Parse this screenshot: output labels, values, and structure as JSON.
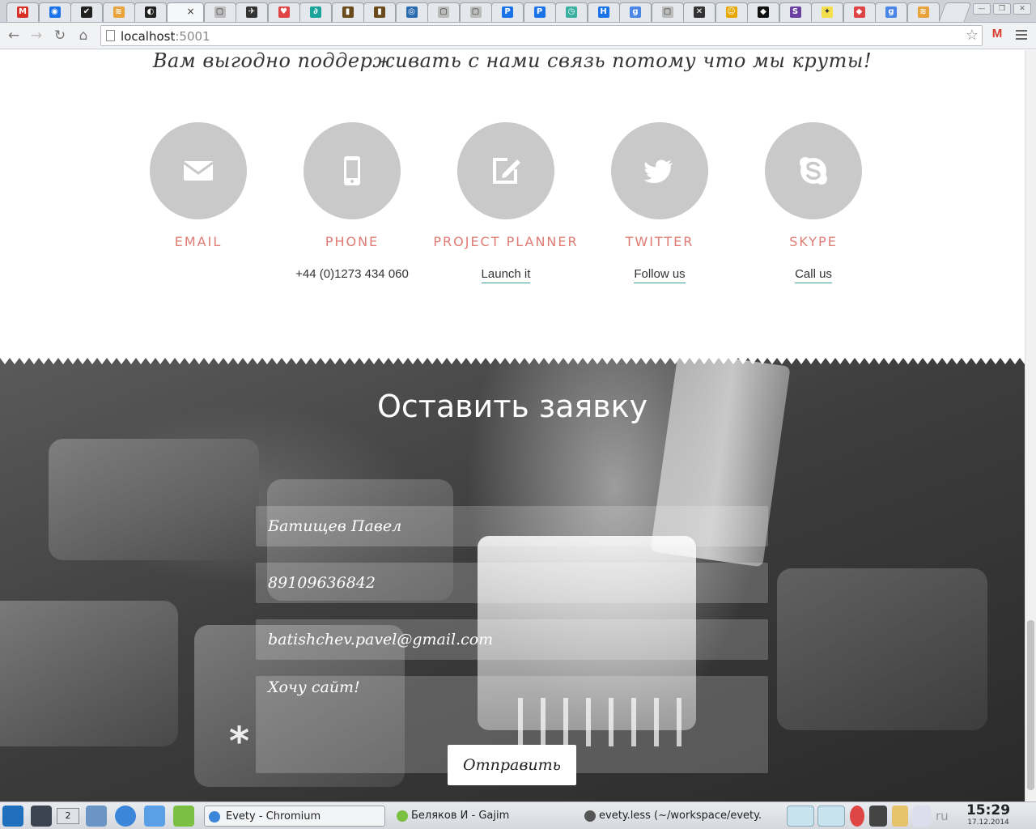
{
  "browser": {
    "active_tab_close": "×",
    "url_host": "localhost",
    "url_port": ":5001",
    "tab_favicons": [
      "M",
      "◉",
      "✔",
      "≋",
      "◐",
      "×",
      "▢",
      "✈",
      "♥",
      "∂",
      "▮",
      "▮",
      "◎",
      "▢",
      "▢",
      "P",
      "P",
      "◷",
      "H",
      "g",
      "▢",
      "✕",
      "☺",
      "◆",
      "S",
      "✦",
      "◆",
      "g",
      "≋"
    ],
    "gmail_ext": "M"
  },
  "page": {
    "tagline": "Вам выгодно поддерживать с нами связь потому что мы круты!",
    "contacts": [
      {
        "title": "EMAIL",
        "icon": "envelope-icon"
      },
      {
        "title": "PHONE",
        "icon": "phone-icon",
        "text": "+44 (0)1273 434 060"
      },
      {
        "title": "PROJECT PLANNER",
        "icon": "edit-icon",
        "link": "Launch it"
      },
      {
        "title": "TWITTER",
        "icon": "twitter-icon",
        "link": "Follow us"
      },
      {
        "title": "SKYPE",
        "icon": "skype-icon",
        "link": "Call us"
      }
    ],
    "form": {
      "title": "Оставить заявку",
      "name_value": "Батищев Павел",
      "phone_value": "89109636842",
      "email_value": "batishchev.pavel@gmail.com",
      "message_value": "Хочу сайт!",
      "submit_label": "Отправить"
    }
  },
  "taskbar": {
    "pager_label": "2",
    "tasks": [
      {
        "label": "Evety - Chromium"
      },
      {
        "label": "Беляков И - Gajim"
      },
      {
        "label": "evety.less (~/workspace/evety.c"
      }
    ],
    "lang": "ru",
    "time": "15:29",
    "date": "17.12.2014"
  },
  "colors": {
    "accent_title": "#e07b73",
    "link_underline": "#3aa0a0",
    "circle_bg": "#c9c9c9"
  }
}
